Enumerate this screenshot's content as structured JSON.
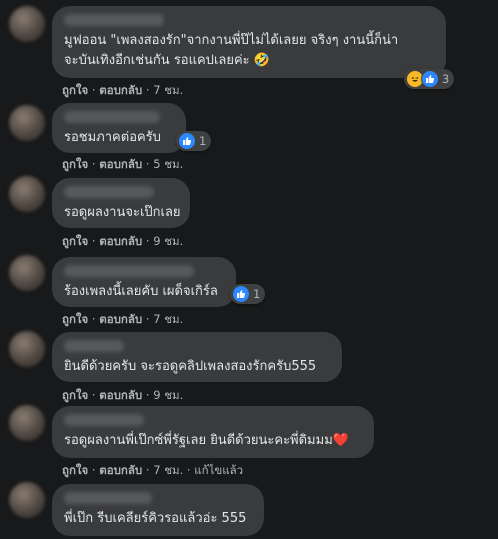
{
  "actions": {
    "like": "ถูกใจ",
    "reply": "ตอบกลับ",
    "sep": " · "
  },
  "comments": [
    {
      "text": "มูฟออน \"เพลงสองรัก\"จากงานพี่ป๊ไม่ได้เลยย จริงๆ งานนี้ก็น่า",
      "text2": "จะบันเทิงอีกเช่นกัน รอแคปเลยค่ะ 🤣",
      "time": "7 ชม.",
      "reactions": [
        "haha",
        "like"
      ],
      "reaction_count": "3"
    },
    {
      "text": "รอชมภาคต่อครับ",
      "time": "5 ชม.",
      "reactions": [
        "like"
      ],
      "reaction_count": "1"
    },
    {
      "text": "รอดูผลงานจะเป๊กเลย",
      "time": "9 ชม."
    },
    {
      "text": "ร้องเพลงนี้เลยคับ เผด็จเกิร์ล",
      "time": "7 ชม.",
      "reactions": [
        "like"
      ],
      "reaction_count": "1"
    },
    {
      "text": "ยินดีด้วยครับ จะรอดูคลิปเพลงสองรักครับ555",
      "time": "9 ชม."
    },
    {
      "text": "รอดูผลงานพี่เป๊กซ์พี่รัฐเลย ยินดีด้วยนะคะพี่ดิมมม❤️",
      "time": "7 ชม.",
      "edited": "แก้ไขแล้ว"
    },
    {
      "text": "พี่เป๊ก รีบเคลียร์คิวรอแล้วอ่ะ 555"
    }
  ],
  "colors": {
    "background": "#18191a",
    "bubble": "#3a3b3c",
    "text": "#e4e6eb",
    "meta": "#b0b3b8",
    "like": "#2d88ff"
  }
}
